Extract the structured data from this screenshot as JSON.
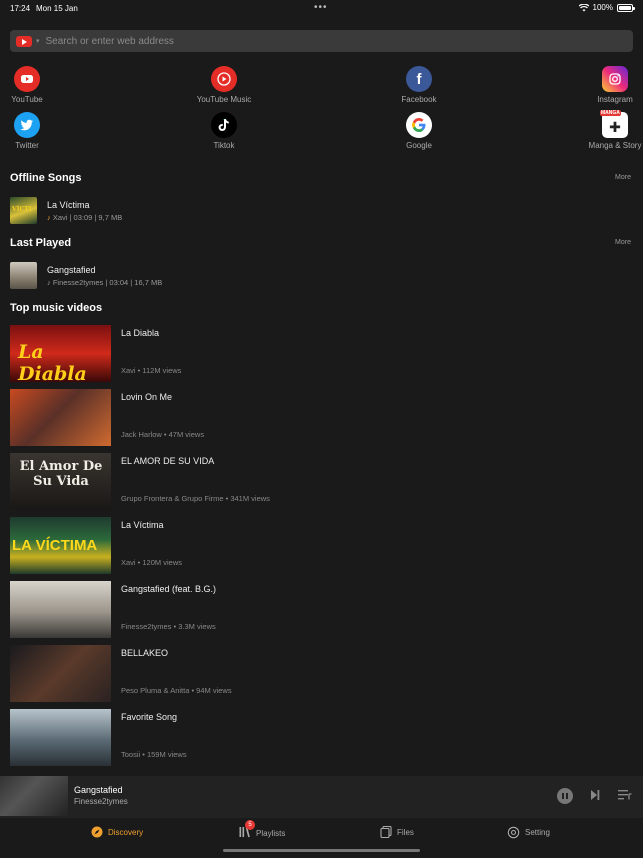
{
  "status_bar": {
    "time": "17:24",
    "date": "Mon 15 Jan",
    "battery": "100%"
  },
  "search": {
    "placeholder": "Search or enter web address"
  },
  "shortcuts": [
    {
      "label": "YouTube",
      "icon": "youtube-icon",
      "color": "#e52d27"
    },
    {
      "label": "YouTube Music",
      "icon": "youtube-music-icon",
      "color": "#e52d27"
    },
    {
      "label": "Facebook",
      "icon": "facebook-icon",
      "color": "#3b5998"
    },
    {
      "label": "Instagram",
      "icon": "instagram-icon",
      "color": "#d6249f"
    },
    {
      "label": "Twitter",
      "icon": "twitter-icon",
      "color": "#1da1f2"
    },
    {
      "label": "Tiktok",
      "icon": "tiktok-icon",
      "color": "#000000"
    },
    {
      "label": "Google",
      "icon": "google-icon",
      "color": "#ffffff"
    },
    {
      "label": "Manga & Story",
      "icon": "manga-icon",
      "color": "#ffffff"
    }
  ],
  "offline": {
    "title": "Offline Songs",
    "more": "More",
    "items": [
      {
        "title": "La Víctima",
        "meta": "Xavi | 03:09 | 9,7 MB"
      }
    ]
  },
  "last_played": {
    "title": "Last Played",
    "more": "More",
    "items": [
      {
        "title": "Gangstafied",
        "meta": "Finesse2tymes | 03:04 | 16,7 MB"
      }
    ]
  },
  "top_videos": {
    "title": "Top music videos",
    "items": [
      {
        "title": "La Diabla",
        "meta": "Xavi • 112M views",
        "cover_text": "La Diabla"
      },
      {
        "title": "Lovin On Me",
        "meta": "Jack Harlow • 47M views",
        "cover_text": ""
      },
      {
        "title": "EL AMOR DE SU VIDA",
        "meta": "Grupo Frontera & Grupo Firme • 341M views",
        "cover_text": "El Amor De Su Vida"
      },
      {
        "title": "La Víctima",
        "meta": "Xavi • 120M views",
        "cover_text": "LA VÍCTIMA"
      },
      {
        "title": "Gangstafied (feat. B.G.)",
        "meta": "Finesse2tymes • 3.3M views",
        "cover_text": ""
      },
      {
        "title": "BELLAKEO",
        "meta": "Peso Pluma & Anitta • 94M views",
        "cover_text": ""
      },
      {
        "title": "Favorite Song",
        "meta": "Toosii • 159M views",
        "cover_text": ""
      }
    ]
  },
  "mini_player": {
    "title": "Gangstafied",
    "artist": "Finesse2tymes"
  },
  "tabs": [
    {
      "label": "Discovery",
      "icon": "compass-icon",
      "active": true
    },
    {
      "label": "Playlists",
      "icon": "library-icon",
      "badge": "5"
    },
    {
      "label": "Files",
      "icon": "files-icon"
    },
    {
      "label": "Setting",
      "icon": "gear-icon"
    }
  ],
  "colors": {
    "accent": "#f0a030",
    "background": "#1a1a1a"
  }
}
